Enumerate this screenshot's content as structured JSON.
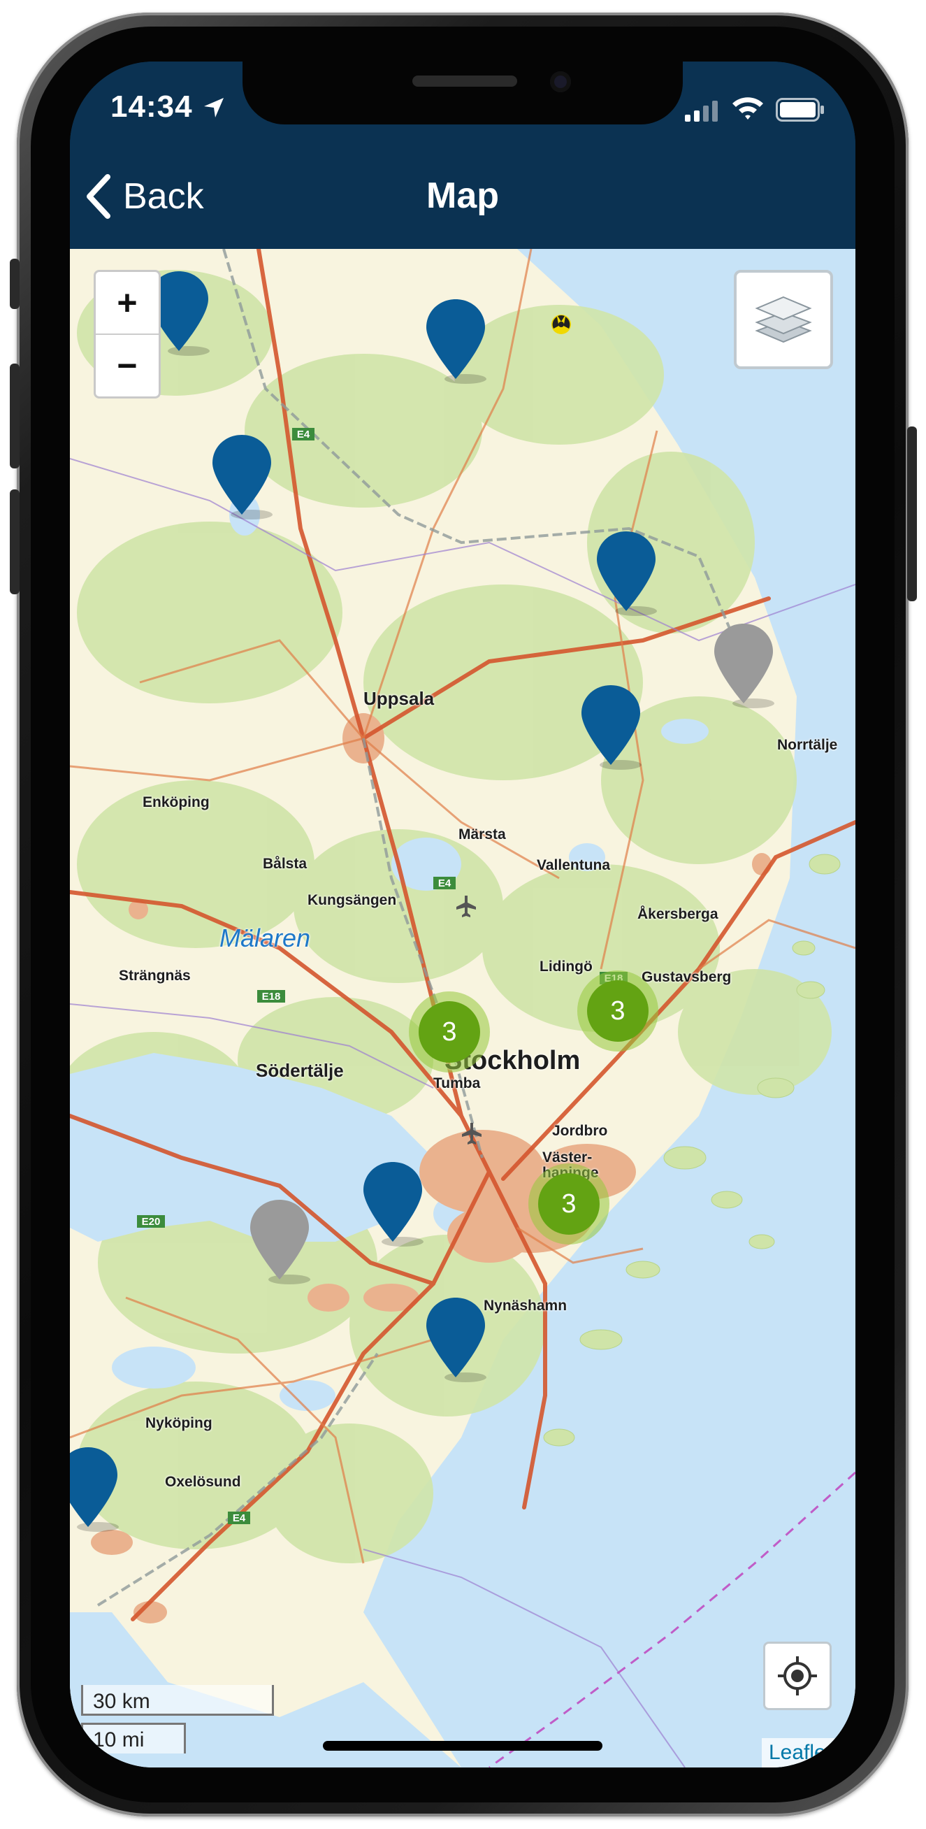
{
  "status_bar": {
    "time": "14:34"
  },
  "nav": {
    "back_label": "Back",
    "title": "Map"
  },
  "map": {
    "places": {
      "uppsala": "Uppsala",
      "enkoping": "Enköping",
      "marsta": "Märsta",
      "balsta": "Bålsta",
      "kungsangen": "Kungsängen",
      "vallentuna": "Vallentuna",
      "akersberga": "Åkersberga",
      "malaren": "Mälaren",
      "strangnas": "Strängnäs",
      "lidingo": "Lidingö",
      "gustavsberg": "Gustavsberg",
      "sodertalje": "Södertälje",
      "stockholm": "Stockholm",
      "tumba": "Tumba",
      "jordbro": "Jordbro",
      "vasterhaninge_1": "Väster-",
      "vasterhaninge_2": "haninge",
      "nynashamn": "Nynäshamn",
      "nykoping": "Nyköping",
      "oxelosund": "Oxelösund",
      "norrtalje": "Norrtälje",
      "e4": "E4",
      "e18": "E18",
      "e20": "E20"
    },
    "clusters": [
      "3",
      "3",
      "3"
    ],
    "zoom_in": "+",
    "zoom_out": "−",
    "scale_km": "30 km",
    "scale_mi": "10 mi",
    "attribution": "Leaflet",
    "marker_colors": {
      "active": "#0a5c97",
      "inactive": "#9a9a9a",
      "cluster": "#63a313"
    },
    "icons": [
      "zoom-in-icon",
      "zoom-out-icon",
      "layers-icon",
      "locate-icon",
      "map-marker-icon",
      "location-arrow-icon",
      "signal-icon",
      "wifi-icon",
      "battery-icon",
      "chevron-left-icon",
      "radiation-icon",
      "airport-icon"
    ]
  }
}
